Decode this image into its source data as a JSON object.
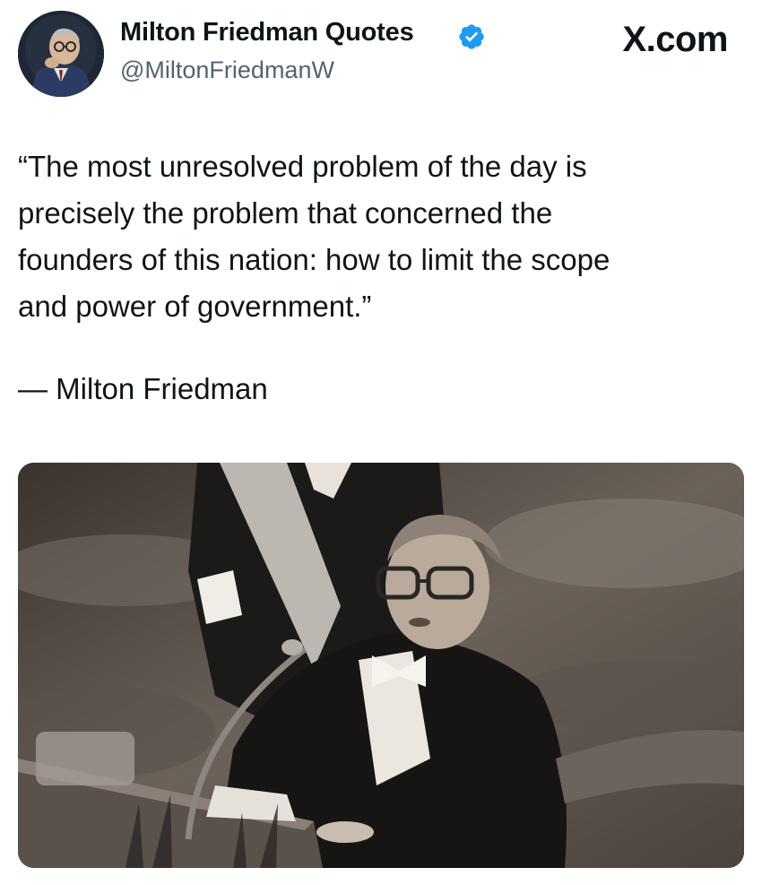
{
  "post": {
    "author": {
      "display_name": "Milton Friedman Quotes",
      "handle": "@MiltonFriedmanW",
      "verified": true
    },
    "brand_label": "X.com",
    "quote_lines": [
      "“The most unresolved problem of the day is",
      "precisely the problem that concerned the",
      "founders of this nation: how to limit the scope",
      "and power of government.”"
    ],
    "attribution": "— Milton Friedman"
  },
  "colors": {
    "verified_badge": "#1d9bf0",
    "handle_text": "#536471",
    "primary_text": "#0f1419"
  },
  "icons": {
    "verified": "verified-badge-icon"
  }
}
